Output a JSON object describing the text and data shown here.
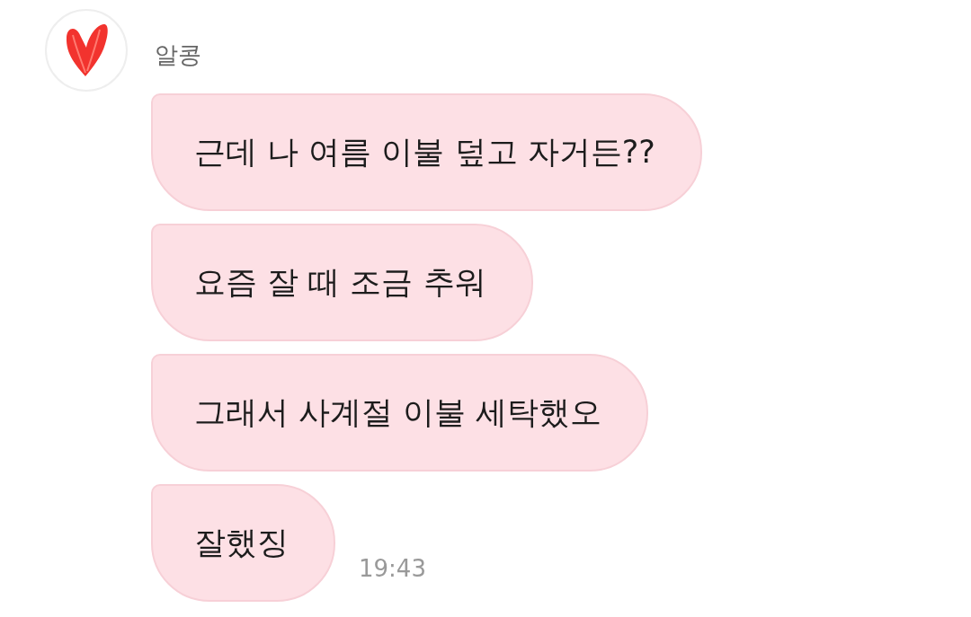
{
  "sender": {
    "name": "알콩"
  },
  "messages": [
    {
      "text": "근데 나 여름 이불 덮고 자거든??"
    },
    {
      "text": "요즘 잘 때 조금 추워"
    },
    {
      "text": "그래서 사계절 이불 세탁했오"
    },
    {
      "text": "잘했징"
    }
  ],
  "time": "19:43"
}
